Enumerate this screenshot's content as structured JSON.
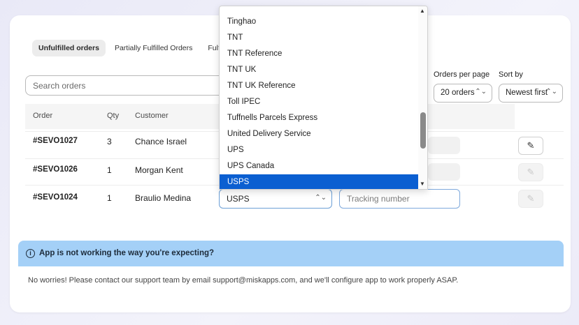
{
  "tabs": [
    {
      "label": "Unfulfilled orders",
      "active": true
    },
    {
      "label": "Partially Fulfilled Orders",
      "active": false
    },
    {
      "label": "Fulfilled Orders",
      "active": false
    }
  ],
  "search": {
    "placeholder": "Search orders"
  },
  "controls": {
    "per_page_label": "Orders per page",
    "per_page_value": "20 orders",
    "sort_label": "Sort by",
    "sort_value": "Newest first"
  },
  "table": {
    "headers": {
      "order": "Order",
      "qty": "Qty",
      "customer": "Customer"
    },
    "rows": [
      {
        "order": "#SEVO1027",
        "qty": "3",
        "customer": "Chance Israel"
      },
      {
        "order": "#SEVO1026",
        "qty": "1",
        "customer": "Morgan Kent"
      },
      {
        "order": "#SEVO1024",
        "qty": "1",
        "customer": "Braulio Medina"
      }
    ]
  },
  "carrier": {
    "selected": "USPS",
    "tracking_placeholder": "Tracking number"
  },
  "dropdown": {
    "items": [
      "Tinghao",
      "TNT",
      "TNT Reference",
      "TNT UK",
      "TNT UK Reference",
      "Toll IPEC",
      "Tuffnells Parcels Express",
      "United Delivery Service",
      "UPS",
      "UPS Canada",
      "USPS"
    ],
    "selected": "USPS"
  },
  "banner": {
    "title": "App is not working the way you're expecting?",
    "message": "No worries! Please contact our support team by email support@miskapps.com, and we'll configure app to work properly ASAP."
  },
  "colors": {
    "selected_item": "#0b5fd1",
    "banner_bg": "#a4d0f7"
  },
  "icons": [
    "edit-icon",
    "info-icon",
    "chevron-updown-icon",
    "scroll-up-arrow",
    "scroll-down-arrow"
  ]
}
